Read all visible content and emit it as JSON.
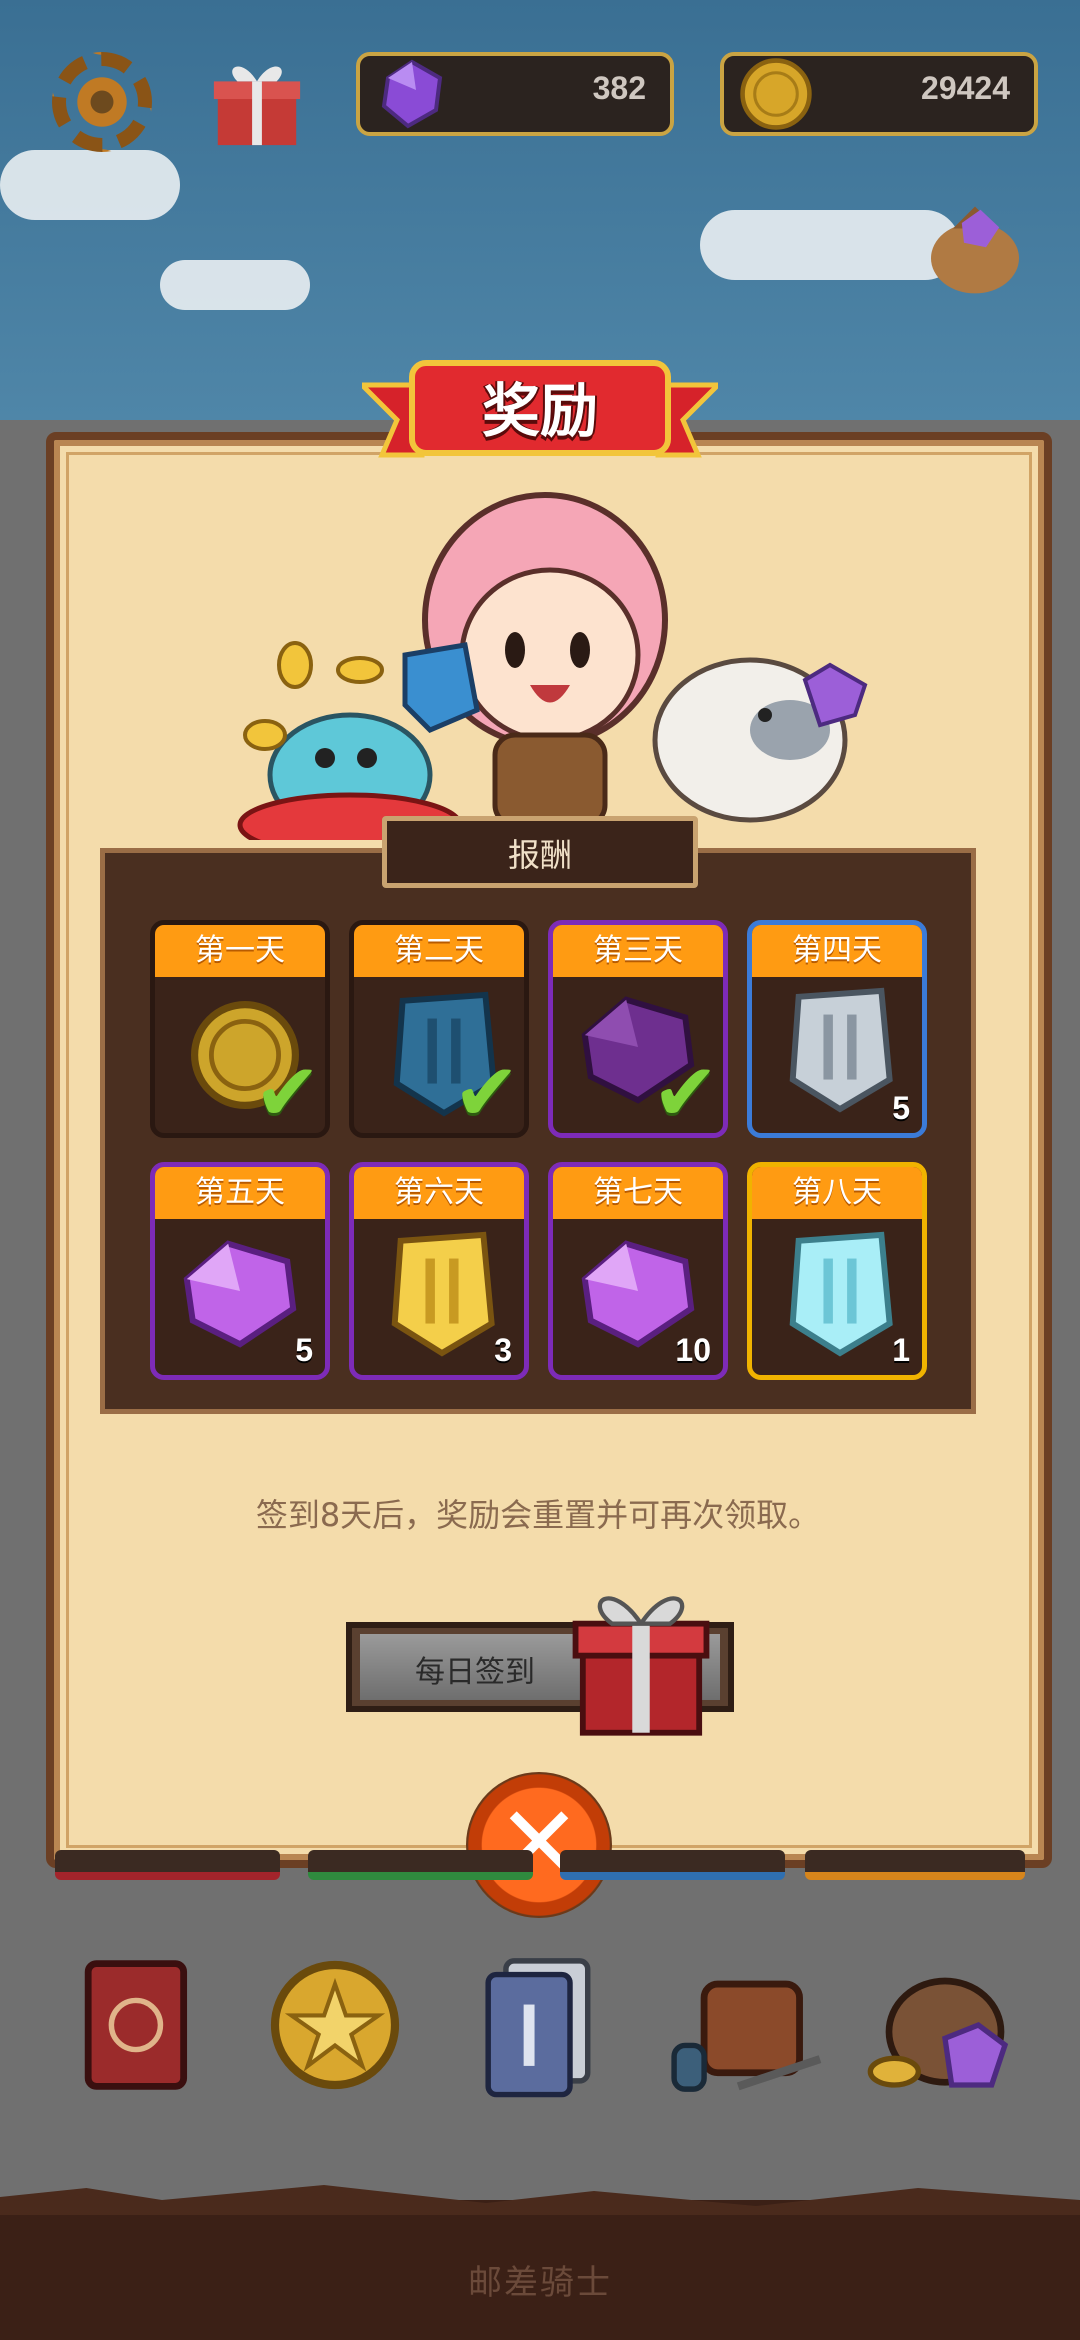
{
  "hud": {
    "gems": "382",
    "coins": "29424"
  },
  "modal": {
    "title": "奖励",
    "section_title": "报酬",
    "days": [
      {
        "label": "第一天",
        "item": "gold-coin-icon",
        "count": "",
        "claimed": true
      },
      {
        "label": "第二天",
        "item": "blue-shield-icon",
        "count": "",
        "claimed": true
      },
      {
        "label": "第三天",
        "item": "purple-gem-icon",
        "count": "",
        "claimed": true
      },
      {
        "label": "第四天",
        "item": "silver-shield-icon",
        "count": "5",
        "claimed": false
      },
      {
        "label": "第五天",
        "item": "purple-gem-icon",
        "count": "5",
        "claimed": false
      },
      {
        "label": "第六天",
        "item": "gold-shield-icon",
        "count": "3",
        "claimed": false
      },
      {
        "label": "第七天",
        "item": "purple-gem-icon",
        "count": "10",
        "claimed": false
      },
      {
        "label": "第八天",
        "item": "ice-shield-icon",
        "count": "1",
        "claimed": false
      }
    ],
    "note": "签到8天后，奖励会重置并可再次领取。",
    "checkin_label": "每日签到"
  },
  "footer": {
    "title": "邮差骑士"
  },
  "colors": {
    "tab_orange": "#ff9b12",
    "parchment": "#f4dcab",
    "check_green": "#7ed33a"
  }
}
